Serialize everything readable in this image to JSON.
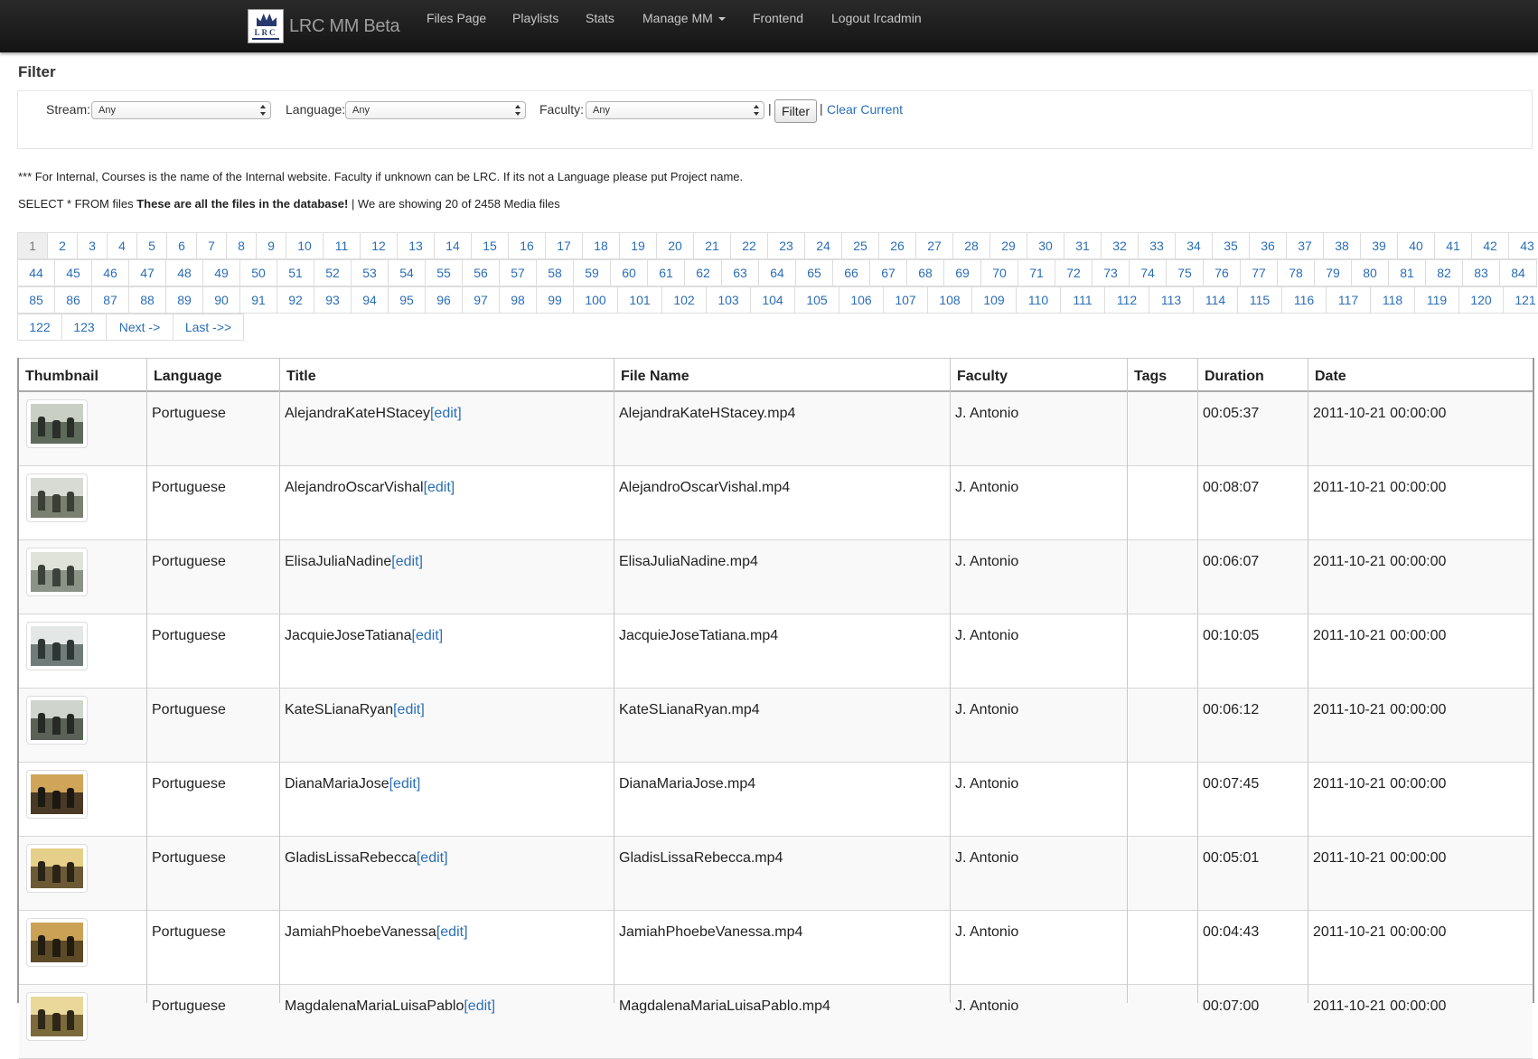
{
  "nav": {
    "brand": "LRC MM Beta",
    "logo_text": "LRC",
    "items": [
      "Files Page",
      "Playlists",
      "Stats",
      "Manage MM",
      "Frontend",
      "Logout lrcadmin"
    ]
  },
  "filter": {
    "title": "Filter",
    "stream_label": "Stream:",
    "stream_value": "Any",
    "language_label": "Language:",
    "language_value": "Any",
    "faculty_label": "Faculty:",
    "faculty_value": "Any",
    "separator": "|",
    "button": "Filter",
    "clear": "Clear Current"
  },
  "note": "*** For Internal, Courses is the name of the Internal website. Faculty if unknown can be LRC. If its not a Language please put Project name.",
  "query": {
    "prefix": "SELECT * FROM files ",
    "bold": "These are all the files in the database!",
    "suffix": " | We are showing 20 of 2458 Media files"
  },
  "pagination": {
    "pages": [
      "1",
      "2",
      "3",
      "4",
      "5",
      "6",
      "7",
      "8",
      "9",
      "10",
      "11",
      "12",
      "13",
      "14",
      "15",
      "16",
      "17",
      "18",
      "19",
      "20",
      "21",
      "22",
      "23",
      "24",
      "25",
      "26",
      "27",
      "28",
      "29",
      "30",
      "31",
      "32",
      "33",
      "34",
      "35",
      "36",
      "37",
      "38",
      "39",
      "40",
      "41",
      "42",
      "43",
      "44",
      "45",
      "46",
      "47",
      "48",
      "49",
      "50",
      "51",
      "52",
      "53",
      "54",
      "55",
      "56",
      "57",
      "58",
      "59",
      "60",
      "61",
      "62",
      "63",
      "64",
      "65",
      "66",
      "67",
      "68",
      "69",
      "70",
      "71",
      "72",
      "73",
      "74",
      "75",
      "76",
      "77",
      "78",
      "79",
      "80",
      "81",
      "82",
      "83",
      "84",
      "85",
      "86",
      "87",
      "88",
      "89",
      "90",
      "91",
      "92",
      "93",
      "94",
      "95",
      "96",
      "97",
      "98",
      "99",
      "100",
      "101",
      "102",
      "103",
      "104",
      "105",
      "106",
      "107",
      "108",
      "109",
      "110",
      "111",
      "112",
      "113",
      "114",
      "115",
      "116",
      "117",
      "118",
      "119",
      "120",
      "121",
      "122",
      "123"
    ],
    "next": "Next ->",
    "last": "Last ->>",
    "active": "1"
  },
  "table": {
    "headers": [
      "Thumbnail",
      "Language",
      "Title",
      "File Name",
      "Faculty",
      "Tags",
      "Duration",
      "Date"
    ],
    "edit_label": "[edit]",
    "rows": [
      {
        "language": "Portuguese",
        "title": "AlejandraKateHStacey",
        "file": "AlejandraKateHStacey.mp4",
        "faculty": "J. Antonio",
        "tags": "",
        "duration": "00:05:37",
        "date": "2011-10-21 00:00:00"
      },
      {
        "language": "Portuguese",
        "title": "AlejandroOscarVishal",
        "file": "AlejandroOscarVishal.mp4",
        "faculty": "J. Antonio",
        "tags": "",
        "duration": "00:08:07",
        "date": "2011-10-21 00:00:00"
      },
      {
        "language": "Portuguese",
        "title": "ElisaJuliaNadine",
        "file": "ElisaJuliaNadine.mp4",
        "faculty": "J. Antonio",
        "tags": "",
        "duration": "00:06:07",
        "date": "2011-10-21 00:00:00"
      },
      {
        "language": "Portuguese",
        "title": "JacquieJoseTatiana",
        "file": "JacquieJoseTatiana.mp4",
        "faculty": "J. Antonio",
        "tags": "",
        "duration": "00:10:05",
        "date": "2011-10-21 00:00:00"
      },
      {
        "language": "Portuguese",
        "title": "KateSLianaRyan",
        "file": "KateSLianaRyan.mp4",
        "faculty": "J. Antonio",
        "tags": "",
        "duration": "00:06:12",
        "date": "2011-10-21 00:00:00"
      },
      {
        "language": "Portuguese",
        "title": "DianaMariaJose",
        "file": "DianaMariaJose.mp4",
        "faculty": "J. Antonio",
        "tags": "",
        "duration": "00:07:45",
        "date": "2011-10-21 00:00:00"
      },
      {
        "language": "Portuguese",
        "title": "GladisLissaRebecca",
        "file": "GladisLissaRebecca.mp4",
        "faculty": "J. Antonio",
        "tags": "",
        "duration": "00:05:01",
        "date": "2011-10-21 00:00:00"
      },
      {
        "language": "Portuguese",
        "title": "JamiahPhoebeVanessa",
        "file": "JamiahPhoebeVanessa.mp4",
        "faculty": "J. Antonio",
        "tags": "",
        "duration": "00:04:43",
        "date": "2011-10-21 00:00:00"
      },
      {
        "language": "Portuguese",
        "title": "MagdalenaMariaLuisaPablo",
        "file": "MagdalenaMariaLuisaPablo.mp4",
        "faculty": "J. Antonio",
        "tags": "",
        "duration": "00:07:00",
        "date": "2011-10-21 00:00:00"
      }
    ]
  },
  "colors": {
    "navbar": "#1b1b1b",
    "link": "#2a6eb7",
    "row_stripe": "#f9f9f9"
  }
}
